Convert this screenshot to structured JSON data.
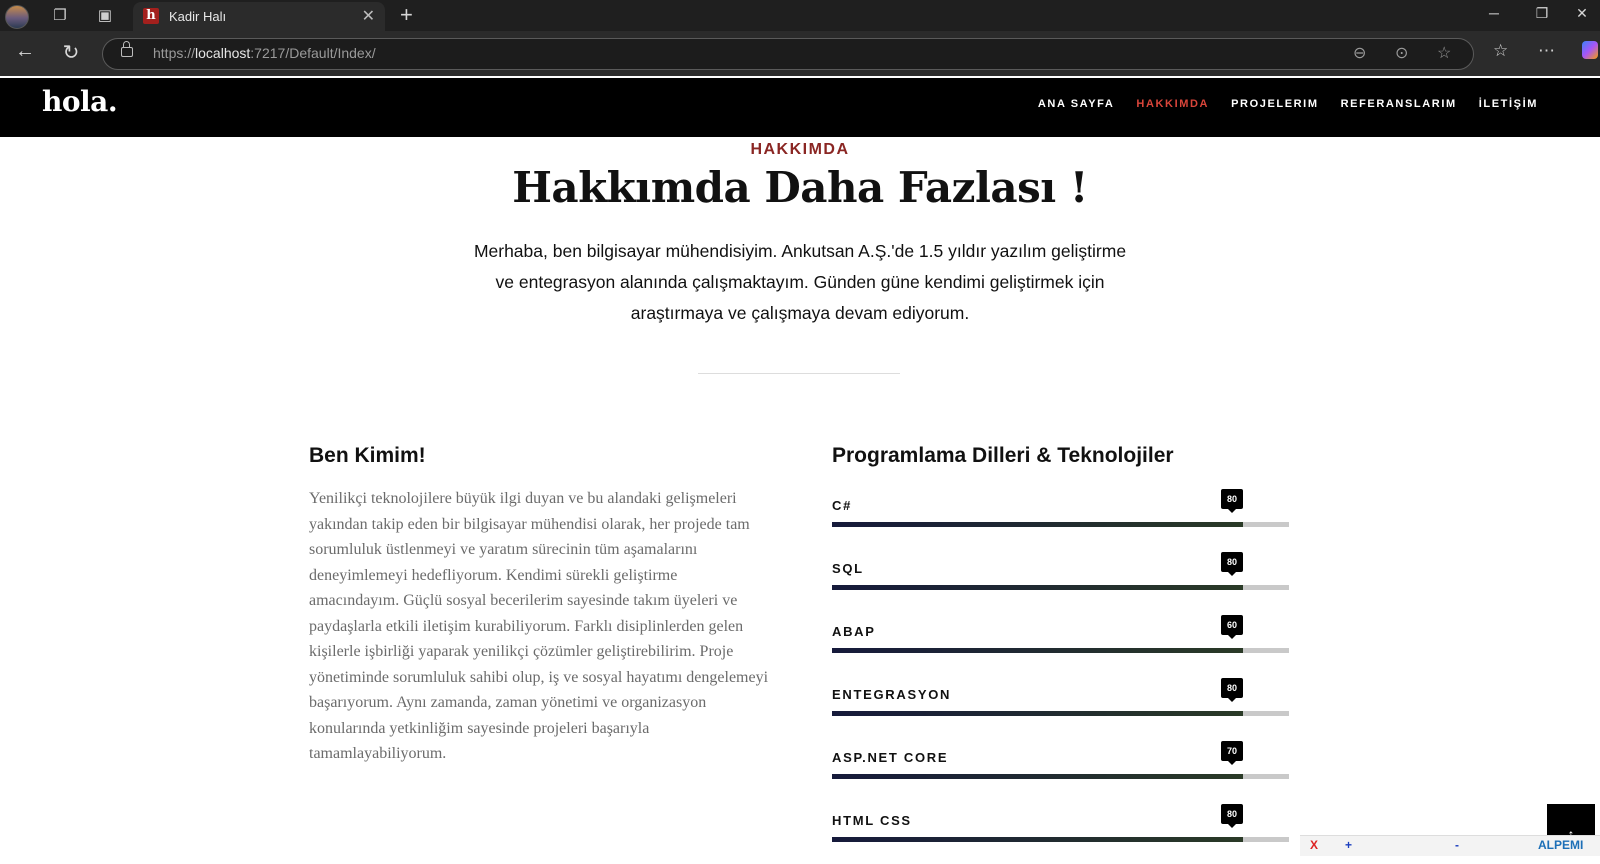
{
  "browser": {
    "tab_title": "Kadir Halı",
    "favicon_letter": "h",
    "url_scheme": "https://",
    "url_host": "localhost",
    "url_path": ":7217/Default/Index/"
  },
  "site": {
    "logo": "hola.",
    "nav": [
      "ANA SAYFA",
      "HAKKIMDA",
      "PROJELERIM",
      "REFERANSLARIM",
      "İLETİŞİM"
    ],
    "active_nav": "HAKKIMDA"
  },
  "about": {
    "eyebrow": "HAKKIMDA",
    "title": "Hakkımda Daha Fazlası !",
    "lead": "Merhaba, ben bilgisayar mühendisiyim. Ankutsan A.Ş.'de 1.5 yıldır yazılım geliştirme ve entegrasyon alanında çalışmaktayım. Günden güne kendimi geliştirmek için araştırmaya ve çalışmaya devam ediyorum.",
    "who_title": "Ben Kimim!",
    "bio": "Yenilikçi teknolojilere büyük ilgi duyan ve bu alandaki gelişmeleri yakından takip eden bir bilgisayar mühendisi olarak, her projede tam sorumluluk üstlenmeyi ve yaratım sürecinin tüm aşamalarını deneyimlemeyi hedefliyorum. Kendimi sürekli geliştirme amacındayım. Güçlü sosyal becerilerim sayesinde takım üyeleri ve paydaşlarla etkili iletişim kurabiliyorum. Farklı disiplinlerden gelen kişilerle işbirliği yaparak yenilikçi çözümler geliştirebilirim. Proje yönetiminde sorumluluk sahibi olup, iş ve sosyal hayatımı dengelemeyi başarıyorum. Aynı zamanda, zaman yönetimi ve organizasyon konularında yetkinliğim sayesinde projeleri başarıyla tamamlayabiliyorum.",
    "skills_title": "Programlama Dilleri & Teknolojiler",
    "skills": [
      {
        "name": "C#",
        "value": "80"
      },
      {
        "name": "SQL",
        "value": "80"
      },
      {
        "name": "ABAP",
        "value": "60"
      },
      {
        "name": "ENTEGRASYON",
        "value": "80"
      },
      {
        "name": "ASP.NET CORE",
        "value": "70"
      },
      {
        "name": "HTML CSS",
        "value": "80"
      }
    ]
  },
  "back_to_top": "↑",
  "ad_strip": {
    "close": "X",
    "plus": "+",
    "minus": "-",
    "brand": "ALPEMI"
  }
}
